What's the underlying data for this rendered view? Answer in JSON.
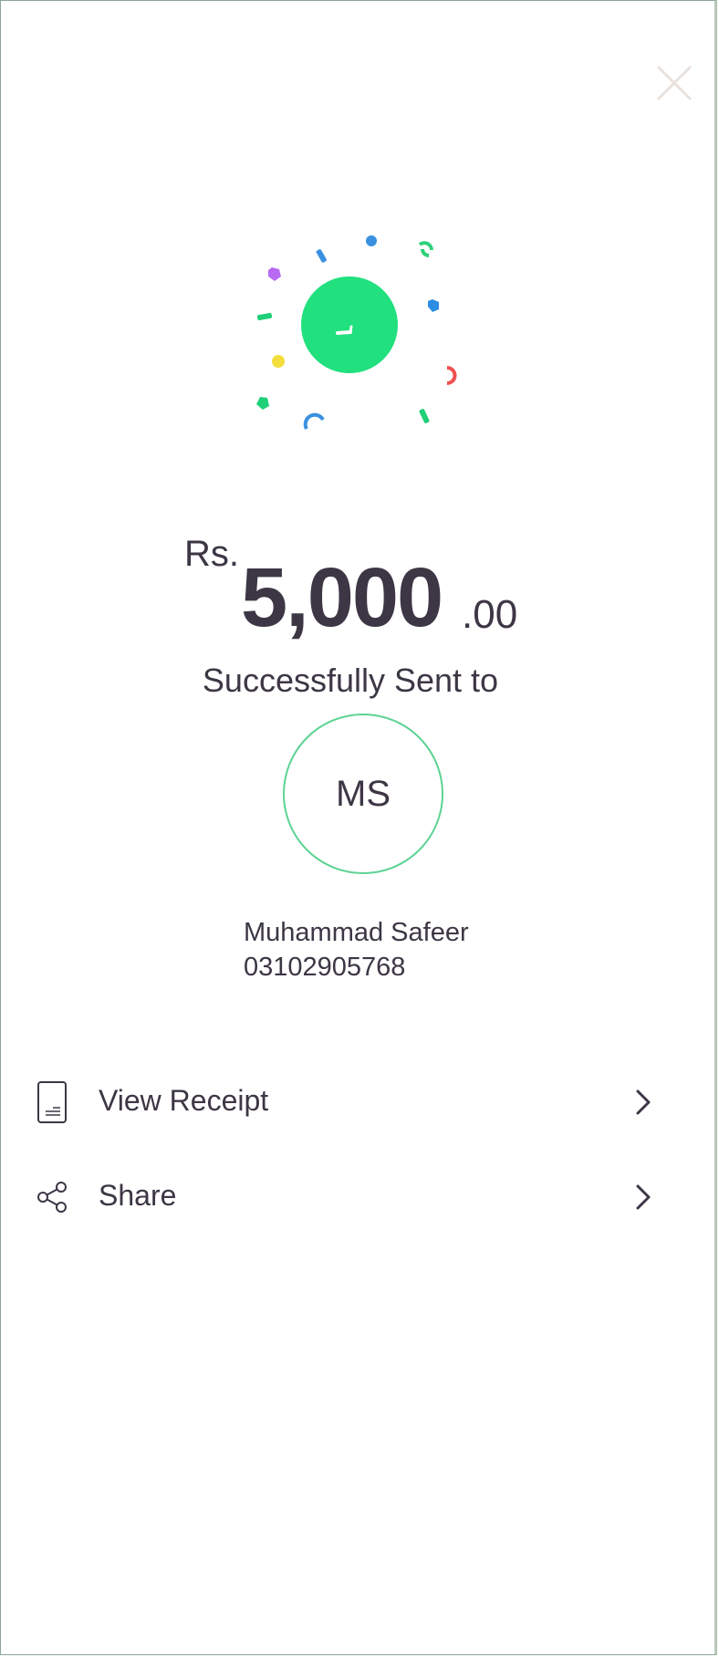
{
  "amount": {
    "currency": "Rs.",
    "whole": "5,000",
    "decimal": ".00"
  },
  "status_text": "Successfully Sent to",
  "recipient": {
    "initials": "MS",
    "name": "Muhammad Safeer",
    "phone": "03102905768"
  },
  "menu": [
    {
      "label": "View Receipt",
      "icon": "receipt-icon"
    },
    {
      "label": "Share",
      "icon": "share-icon"
    }
  ],
  "colors": {
    "accent_green": "#21e07e",
    "avatar_ring": "#5cd393",
    "text": "#3d3645"
  }
}
